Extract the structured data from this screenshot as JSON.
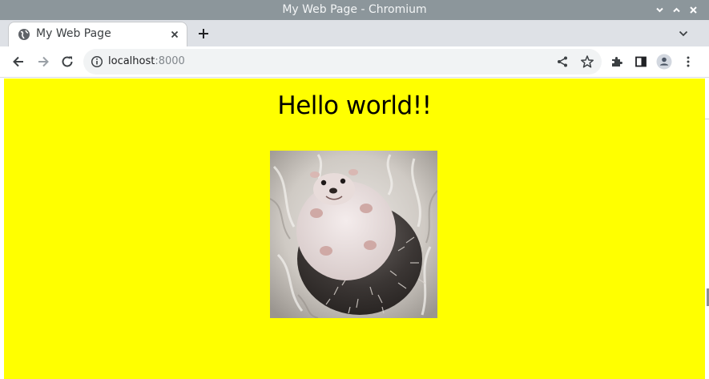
{
  "window": {
    "title": "My Web Page - Chromium"
  },
  "tabs": [
    {
      "title": "My Web Page",
      "active": true
    }
  ],
  "address_bar": {
    "host": "localhost",
    "port": ":8000"
  },
  "page": {
    "heading": "Hello world!!",
    "background_color": "#ffff00",
    "image": {
      "subject": "hedgehog lying on its back on a fluffy white blanket"
    }
  },
  "icons": {
    "minimize": "chevron-down-icon",
    "maximize": "chevron-up-icon",
    "close": "close-icon",
    "favicon": "globe-icon",
    "back": "arrow-left-icon",
    "forward": "arrow-right-icon",
    "reload": "reload-icon",
    "info": "info-icon",
    "share": "share-icon",
    "bookmark": "star-icon",
    "extensions": "puzzle-icon",
    "side_panel": "side-panel-icon",
    "profile": "profile-icon",
    "menu": "kebab-menu-icon"
  }
}
